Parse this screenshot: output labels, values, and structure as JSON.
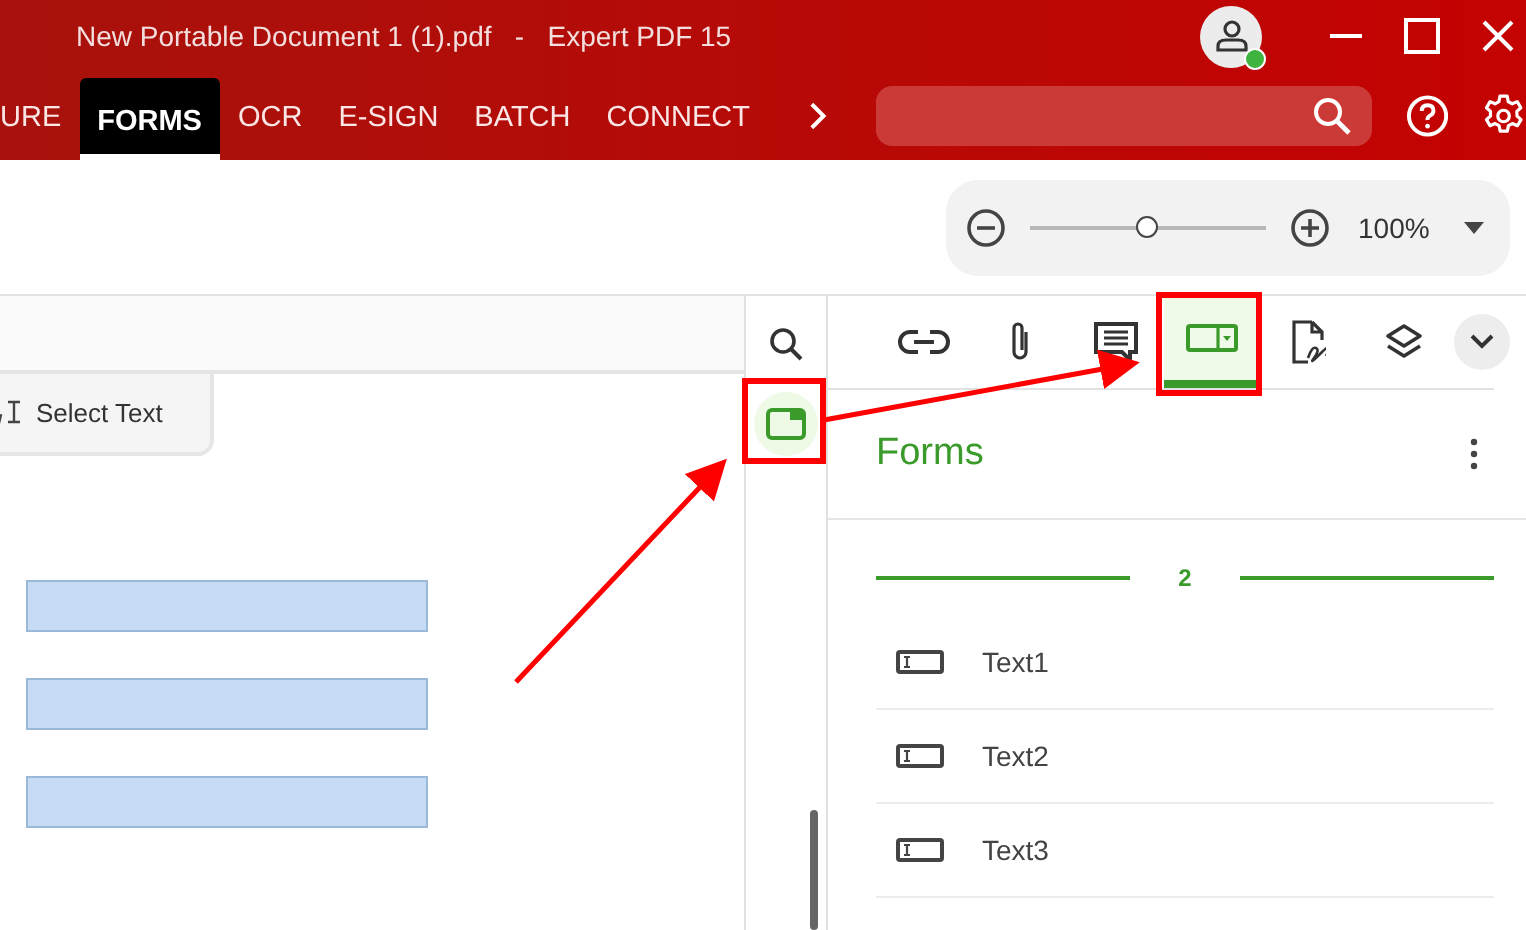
{
  "window": {
    "title": "New Portable Document 1 (1).pdf   -   Expert PDF 15"
  },
  "user": {
    "online": true
  },
  "ribbon_tabs": [
    {
      "label": "URE",
      "selected": false
    },
    {
      "label": "FORMS",
      "selected": true
    },
    {
      "label": "OCR",
      "selected": false
    },
    {
      "label": "E-SIGN",
      "selected": false
    },
    {
      "label": "BATCH",
      "selected": false
    },
    {
      "label": "CONNECT",
      "selected": false
    }
  ],
  "zoom": {
    "level": 0.5,
    "value": "100%"
  },
  "document": {
    "tool": "Select Text",
    "fields": [
      {
        "kind": "text"
      },
      {
        "kind": "text"
      },
      {
        "kind": "text"
      }
    ]
  },
  "side_strip": [
    {
      "kind": "search",
      "selected": false
    },
    {
      "kind": "forms",
      "selected": true
    }
  ],
  "panel": {
    "tools": [
      {
        "kind": "link",
        "selected": false
      },
      {
        "kind": "attachment",
        "selected": false
      },
      {
        "kind": "comment",
        "selected": false
      },
      {
        "kind": "forms",
        "selected": true
      },
      {
        "kind": "signature",
        "selected": false
      },
      {
        "kind": "layers",
        "selected": false
      }
    ],
    "title": "Forms",
    "group": "2",
    "items": [
      {
        "label": "Text1"
      },
      {
        "label": "Text2"
      },
      {
        "label": "Text3"
      }
    ]
  }
}
